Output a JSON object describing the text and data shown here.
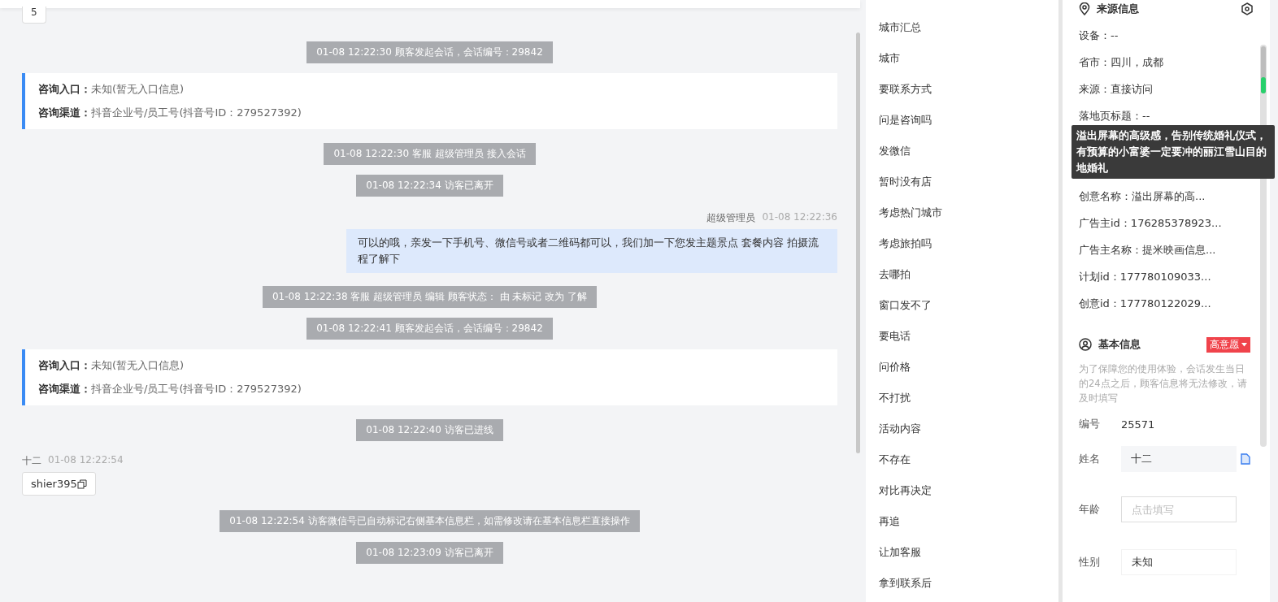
{
  "chat": {
    "events": [
      {
        "kind": "stub",
        "text": "5"
      },
      {
        "kind": "system",
        "text": "01-08 12:22:30 顾客发起会话，会话编号：29842"
      },
      {
        "kind": "entry",
        "lines": [
          {
            "label": "咨询入口：",
            "value": "未知(暂无入口信息)"
          },
          {
            "label": "咨询渠道：",
            "value": "抖音企业号/员工号(抖音号ID：279527392)"
          }
        ]
      },
      {
        "kind": "system",
        "text": "01-08 12:22:30 客服 超级管理员 接入会话"
      },
      {
        "kind": "system",
        "text": "01-08 12:22:34 访客已离开"
      },
      {
        "kind": "agent",
        "sender": "超级管理员",
        "time": "01-08 12:22:36",
        "text": "可以的哦，亲发一下手机号、微信号或者二维码都可以，我们加一下您发主题景点 套餐内容 拍摄流程了解下"
      },
      {
        "kind": "system",
        "text": "01-08 12:22:38 客服 超级管理员 编辑 顾客状态： 由 未标记 改为 了解"
      },
      {
        "kind": "system",
        "text": "01-08 12:22:41 顾客发起会话，会话编号：29842"
      },
      {
        "kind": "entry",
        "lines": [
          {
            "label": "咨询入口：",
            "value": "未知(暂无入口信息)"
          },
          {
            "label": "咨询渠道：",
            "value": "抖音企业号/员工号(抖音号ID：279527392)"
          }
        ]
      },
      {
        "kind": "system",
        "text": "01-08 12:22:40 访客已进线"
      },
      {
        "kind": "visitor",
        "sender": "十二",
        "time": "01-08 12:22:54",
        "text": "shier395"
      },
      {
        "kind": "system",
        "text": "01-08 12:22:54 访客微信号已自动标记右侧基本信息栏，如需修改请在基本信息栏直接操作"
      },
      {
        "kind": "system",
        "text": "01-08 12:23:09 访客已离开"
      }
    ]
  },
  "quick_replies": [
    "城市汇总",
    "城市",
    "要联系方式",
    "问是咨询吗",
    "发微信",
    "暂时没有店",
    "考虑热门城市",
    "考虑旅拍吗",
    "去哪拍",
    "窗口发不了",
    "要电话",
    "问价格",
    "不打扰",
    "活动内容",
    "不存在",
    "对比再决定",
    "再追",
    "让加客服",
    "拿到联系后"
  ],
  "source_info": {
    "title": "来源信息",
    "fields": [
      {
        "kind": "field",
        "text": "设备：--"
      },
      {
        "kind": "field",
        "text": "省市：四川，成都"
      },
      {
        "kind": "field",
        "text": "来源：直接访问"
      },
      {
        "kind": "field",
        "text": "落地页标题：--"
      },
      {
        "kind": "tooltip",
        "text": "溢出屏幕的高级感，告别传统婚礼仪式，有预算的小富婆一定要冲的丽江雪山目的地婚礼"
      },
      {
        "kind": "field",
        "text": "创意名称：溢出屏幕的高..."
      },
      {
        "kind": "field",
        "text": "广告主id：176285378923..."
      },
      {
        "kind": "field",
        "text": "广告主名称：提米映画信息..."
      },
      {
        "kind": "field",
        "text": "计划id：177780109033..."
      },
      {
        "kind": "field",
        "text": "创意id：177780122029..."
      }
    ]
  },
  "basic_info": {
    "title": "基本信息",
    "intent_tag": "高意愿",
    "notice": "为了保障您的使用体验，会话发生当日的24点之后，顾客信息将无法修改，请及时填写",
    "fields": [
      {
        "kind": "text",
        "label": "编号",
        "value": "25571"
      },
      {
        "kind": "copy",
        "label": "姓名",
        "value": "十二"
      },
      {
        "kind": "input",
        "label": "年龄",
        "placeholder": "点击填写"
      },
      {
        "kind": "select",
        "label": "性别",
        "value": "未知"
      }
    ]
  }
}
